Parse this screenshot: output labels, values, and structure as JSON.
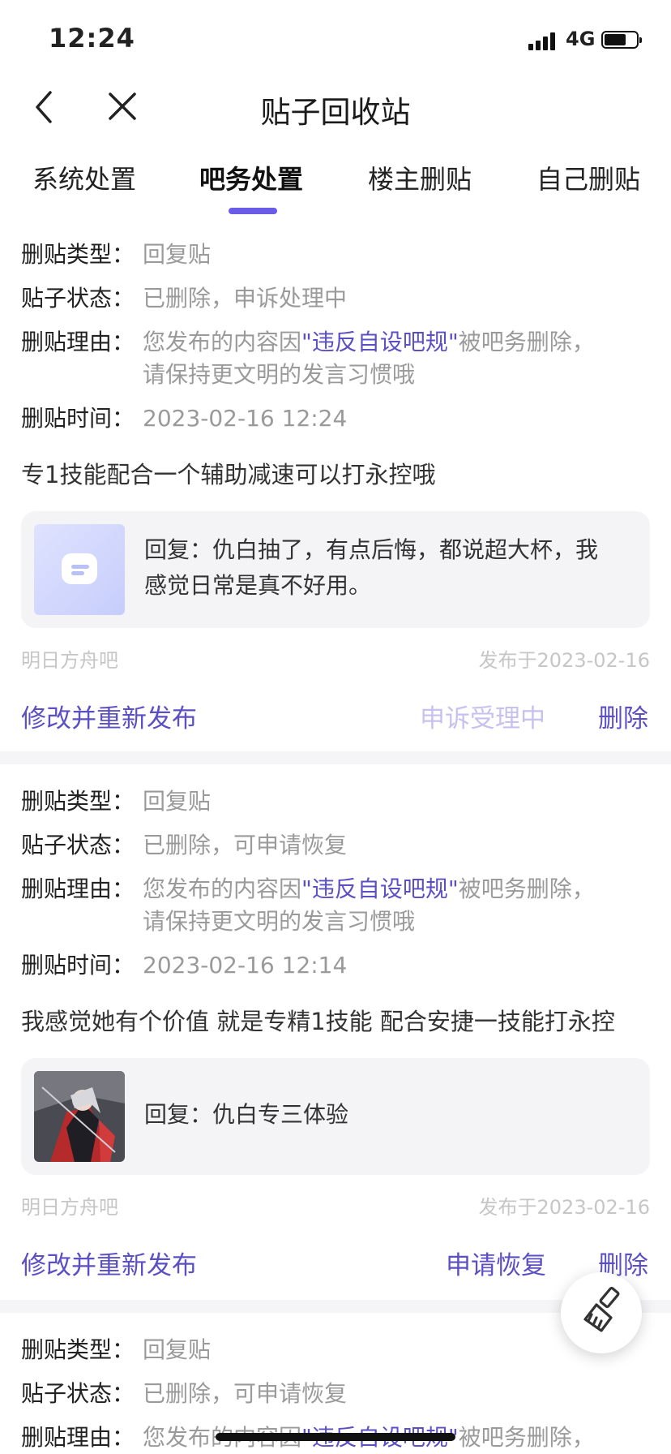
{
  "status_bar": {
    "time": "12:24",
    "network": "4G",
    "battery_level": 0.65
  },
  "nav": {
    "title": "贴子回收站"
  },
  "tabs": [
    {
      "label": "系统处置",
      "active": false
    },
    {
      "label": "吧务处置",
      "active": true
    },
    {
      "label": "楼主删贴",
      "active": false
    },
    {
      "label": "自己删贴",
      "active": false
    }
  ],
  "labels": {
    "type": "删贴类型：",
    "status": "贴子状态：",
    "reason": "删贴理由：",
    "time": "删贴时间："
  },
  "posts": [
    {
      "type": "回复贴",
      "status": "已删除，申诉处理中",
      "reason_prefix": "您发布的内容因",
      "reason_highlight": "\"违反自设吧规\"",
      "reason_suffix": "被吧务删除，",
      "reason_line2": "请保持更文明的发言习惯哦",
      "time": "2023-02-16 12:24",
      "content": "专1技能配合一个辅助减速可以打永控哦",
      "quote_line1": "回复：仇白抽了，有点后悔，都说超大杯，我",
      "quote_line2": "感觉日常是真不好用。",
      "thumb_icon": "chat-bubble-icon",
      "forum": "明日方舟吧",
      "published": "发布于2023-02-16",
      "action_edit": "修改并重新发布",
      "action_middle": "申诉受理中",
      "action_delete": "删除"
    },
    {
      "type": "回复贴",
      "status": "已删除，可申请恢复",
      "reason_prefix": "您发布的内容因",
      "reason_highlight": "\"违反自设吧规\"",
      "reason_suffix": "被吧务删除，",
      "reason_line2": "请保持更文明的发言习惯哦",
      "time": "2023-02-16 12:14",
      "content": "我感觉她有个价值 就是专精1技能 配合安捷一技能打永控",
      "quote_line1": "回复：仇白专三体验",
      "thumb_icon": "character-artwork-icon",
      "forum": "明日方舟吧",
      "published": "发布于2023-02-16",
      "action_edit": "修改并重新发布",
      "action_middle": "申请恢复",
      "action_delete": "删除"
    },
    {
      "type": "回复贴",
      "status": "已删除，可申请恢复",
      "reason_prefix": "您发布的内容因",
      "reason_highlight": "\"违反自设吧规\"",
      "reason_suffix": "被吧务删除，"
    }
  ],
  "colors": {
    "accent": "#5b4fc4",
    "tab_indicator": "#6b5ce7",
    "muted": "#9a9a9a"
  },
  "icons": {
    "back": "chevron-left-icon",
    "close": "close-icon",
    "fab": "broom-icon"
  }
}
